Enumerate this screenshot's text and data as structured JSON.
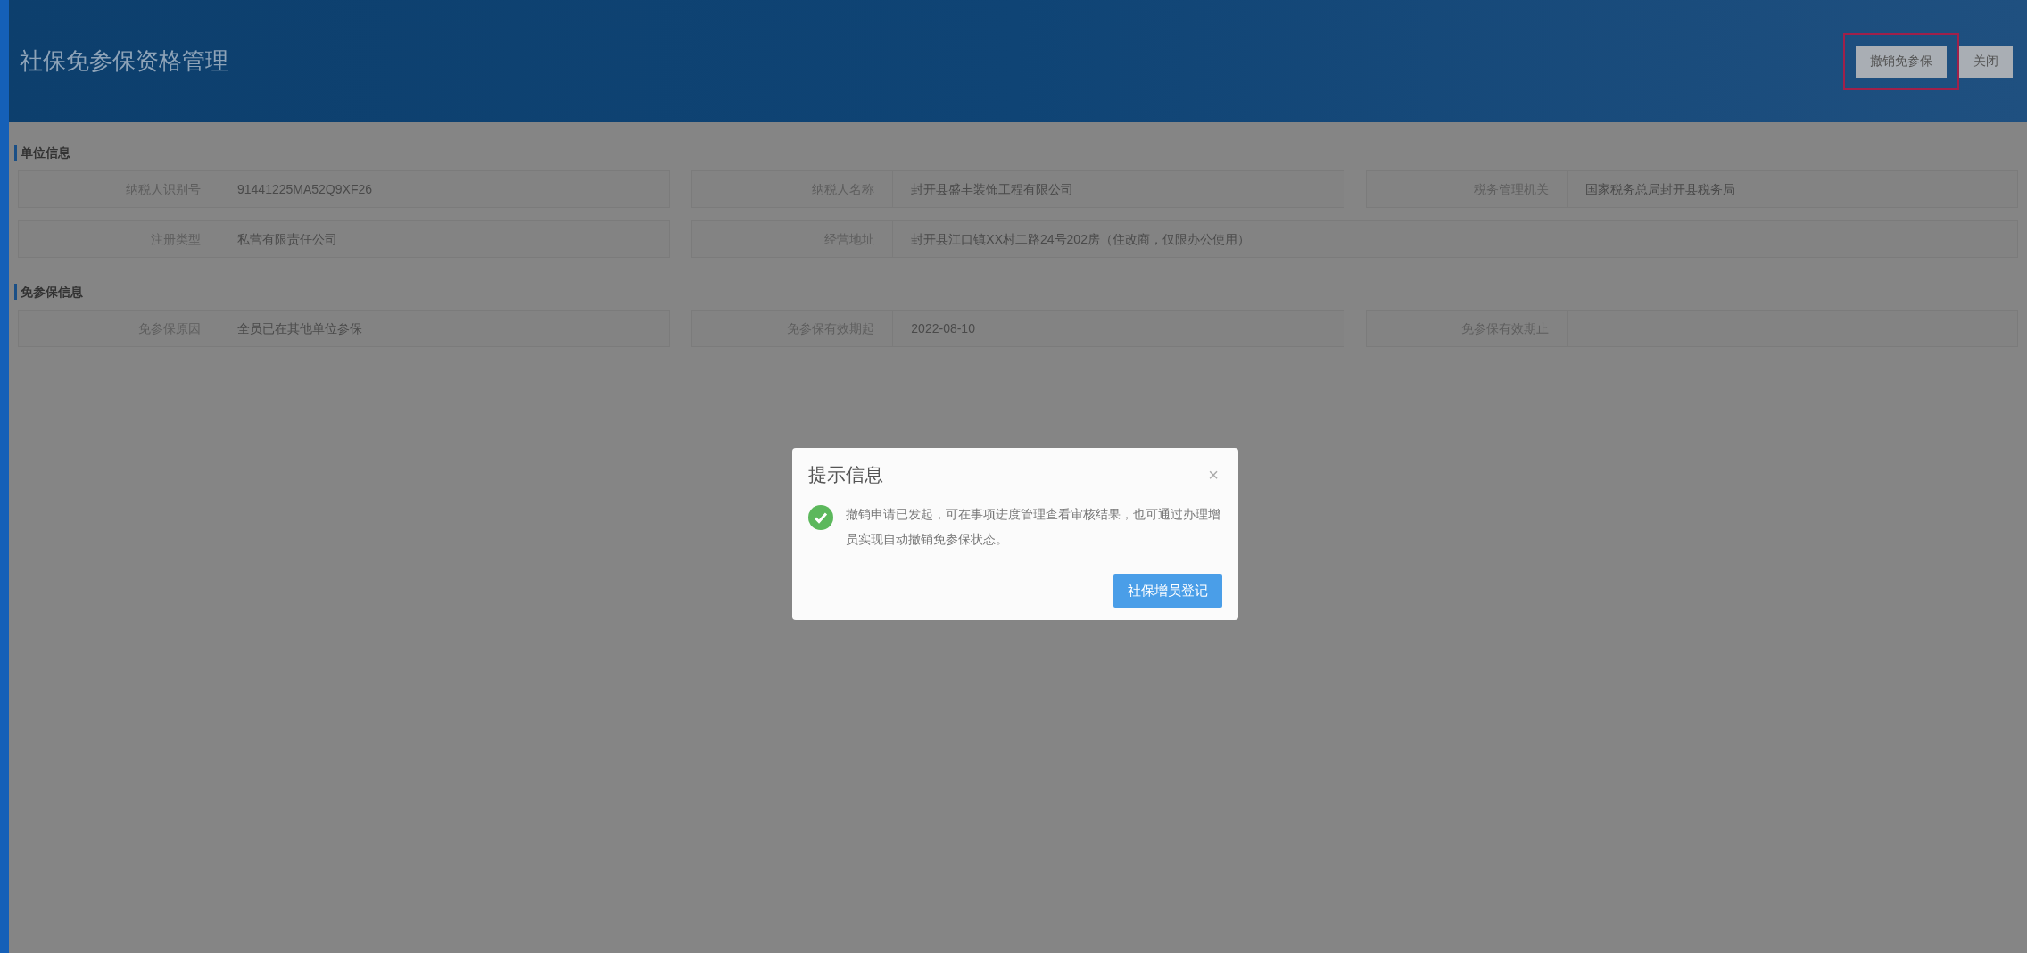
{
  "header": {
    "title": "社保免参保资格管理",
    "buttons": [
      {
        "label": "撤销免参保",
        "highlighted": true
      },
      {
        "label": "关闭",
        "highlighted": false
      }
    ]
  },
  "sections": [
    {
      "title": "单位信息",
      "rows": [
        [
          {
            "label": "纳税人识别号",
            "value": "91441225MA52Q9XF26"
          },
          {
            "label": "纳税人名称",
            "value": "封开县盛丰装饰工程有限公司"
          },
          {
            "label": "税务管理机关",
            "value": "国家税务总局封开县税务局"
          }
        ],
        [
          {
            "label": "注册类型",
            "value": "私营有限责任公司"
          },
          {
            "label": "经营地址",
            "value": "封开县江口镇XX村二路24号202房（住改商，仅限办公使用）",
            "wide": true
          }
        ]
      ]
    },
    {
      "title": "免参保信息",
      "rows": [
        [
          {
            "label": "免参保原因",
            "value": "全员已在其他单位参保"
          },
          {
            "label": "免参保有效期起",
            "value": "2022-08-10"
          },
          {
            "label": "免参保有效期止"
          }
        ]
      ]
    }
  ],
  "dialog": {
    "title": "提示信息",
    "close": "×",
    "message": "撤销申请已发起，可在事项进度管理查看审核结果，也可通过办理增员实现自动撤销免参保状态。",
    "button": "社保增员登记"
  }
}
